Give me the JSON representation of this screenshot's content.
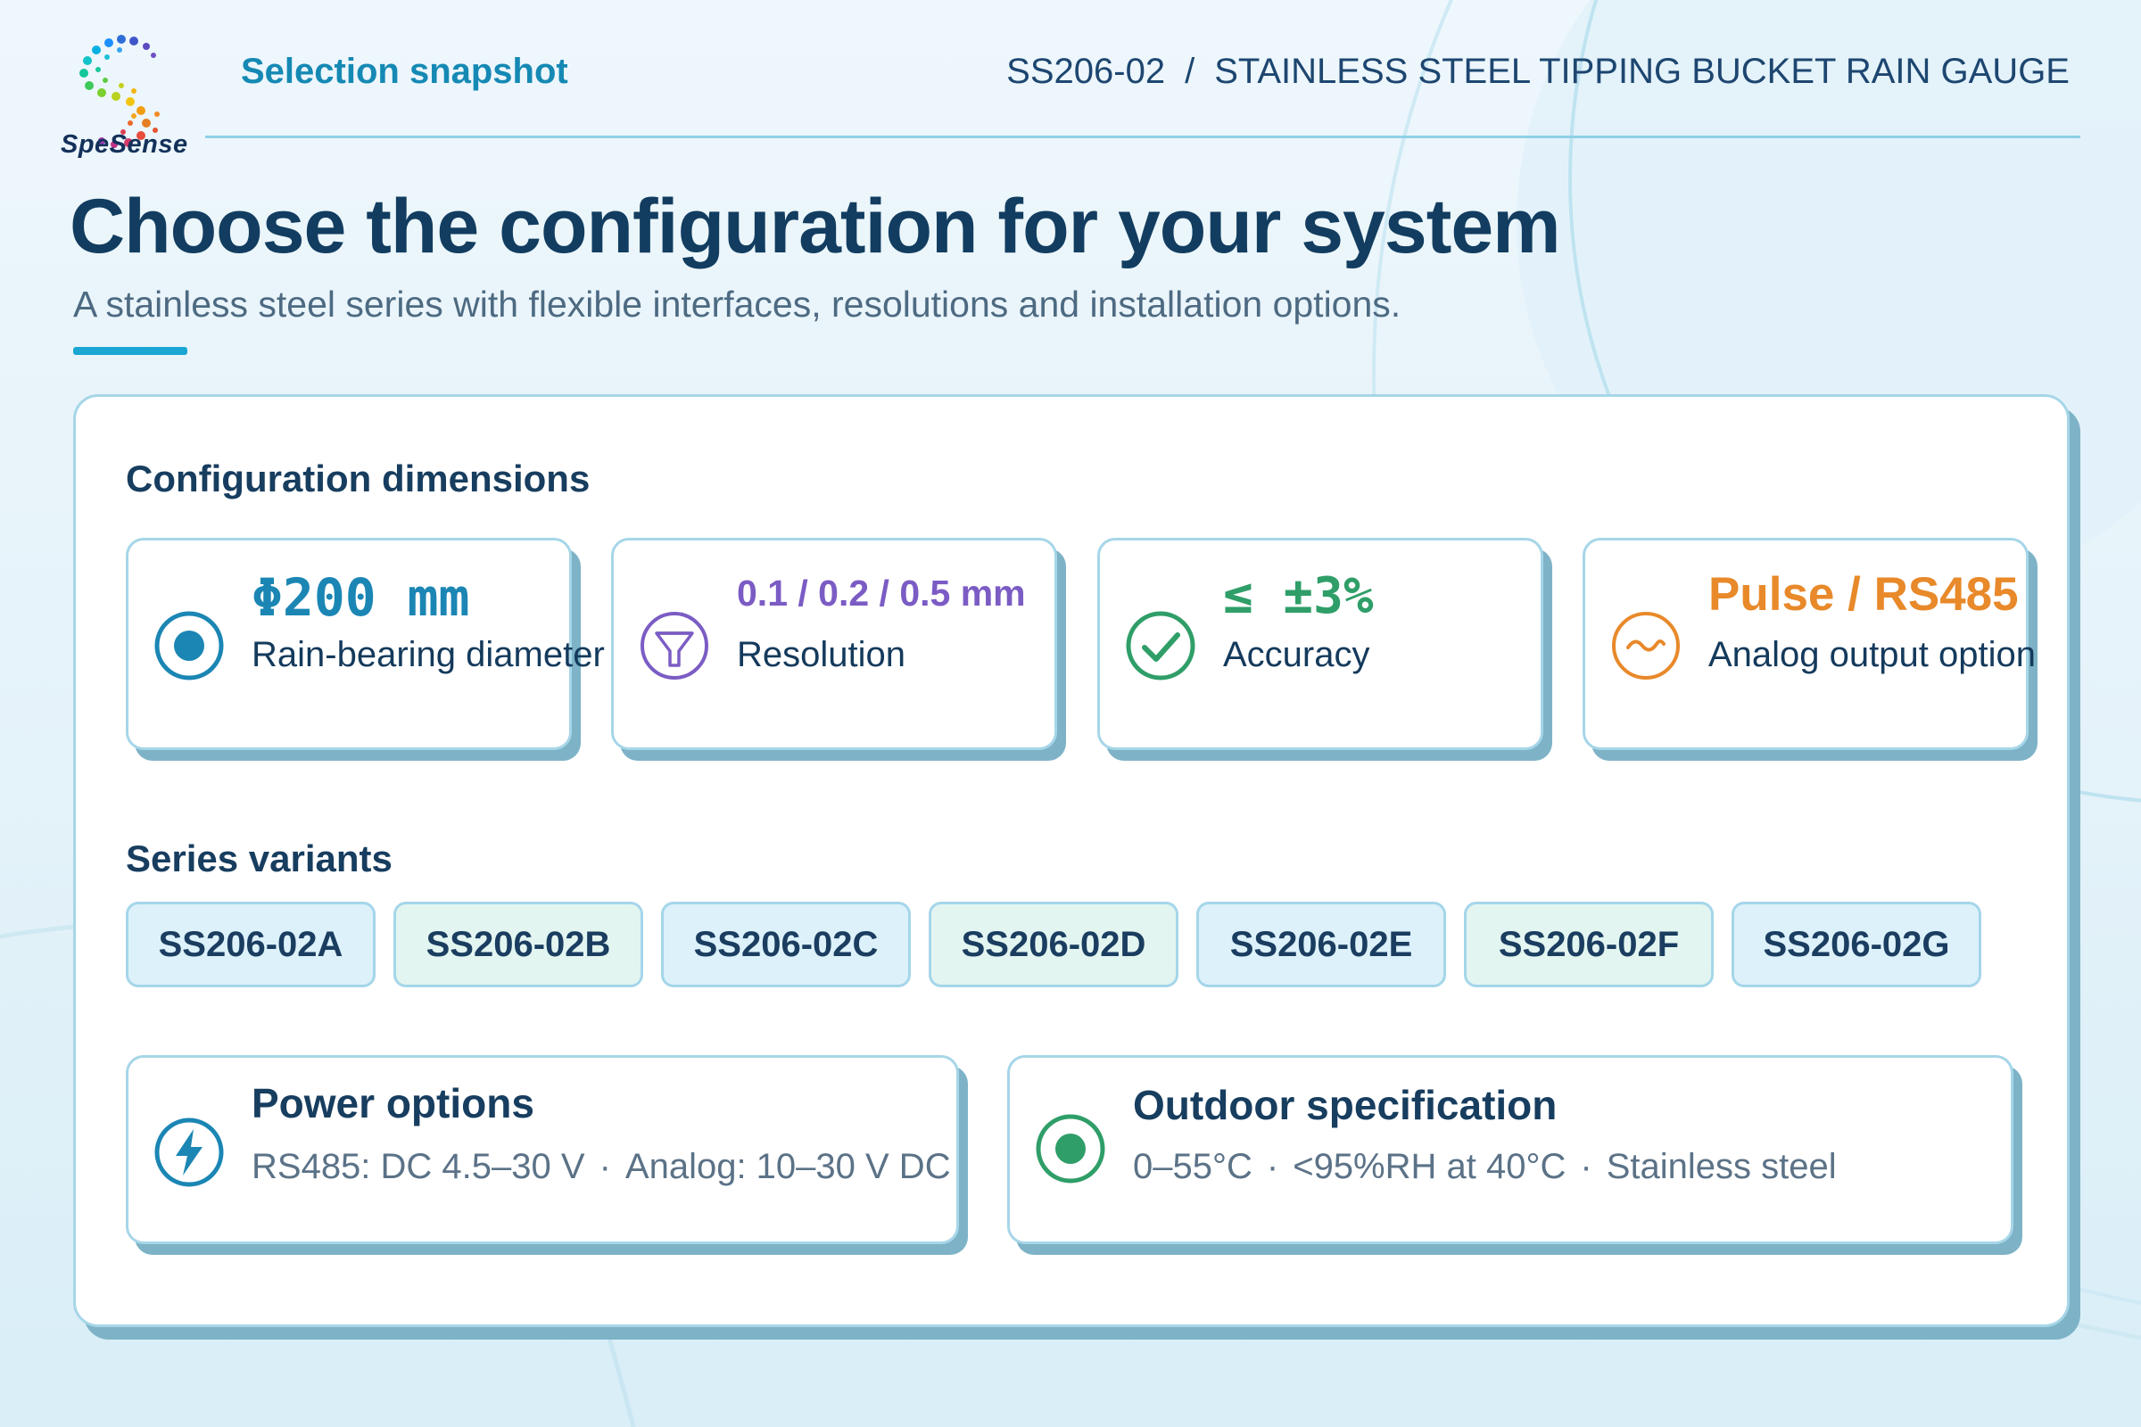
{
  "brand": {
    "name": "SpeSense"
  },
  "header": {
    "snapshot": "Selection snapshot",
    "model": "SS206-02",
    "separator": "/",
    "product": "STAINLESS STEEL TIPPING BUCKET RAIN GAUGE"
  },
  "hero": {
    "title": "Choose the configuration for your system",
    "subtitle": "A stainless steel series with flexible interfaces, resolutions and installation options."
  },
  "dimensions": {
    "title": "Configuration dimensions",
    "cards": [
      {
        "value": "Φ200 mm",
        "label": "Rain-bearing diameter",
        "icon": "radio-dot-icon",
        "color": "#1b86b4"
      },
      {
        "value": "0.1 / 0.2 / 0.5 mm",
        "label": "Resolution",
        "icon": "funnel-icon",
        "color": "#7b5cc4"
      },
      {
        "value": "≤ ±3%",
        "label": "Accuracy",
        "icon": "check-circle-icon",
        "color": "#2f9e68"
      },
      {
        "value": "Pulse / RS485",
        "label": "Analog output option",
        "icon": "signal-wave-icon",
        "color": "#e8892a"
      }
    ]
  },
  "variants": {
    "title": "Series variants",
    "items": [
      "SS206-02A",
      "SS206-02B",
      "SS206-02C",
      "SS206-02D",
      "SS206-02E",
      "SS206-02F",
      "SS206-02G"
    ]
  },
  "power": {
    "title": "Power options",
    "rs485": "RS485: DC 4.5–30 V",
    "dot": "·",
    "analog": "Analog: 10–30 V DC",
    "icon": "lightning-icon"
  },
  "outdoor": {
    "title": "Outdoor specification",
    "temp": "0–55°C",
    "dot": "·",
    "humidity": "<95%RH at 40°C",
    "material": "Stainless steel",
    "icon": "green-dot-icon"
  }
}
